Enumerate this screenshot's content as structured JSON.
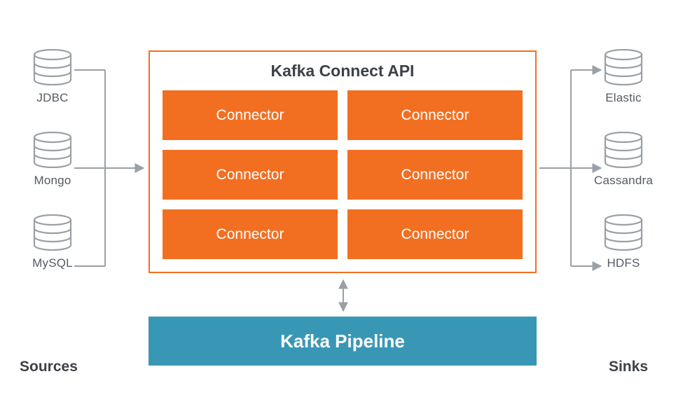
{
  "connect": {
    "title": "Kafka Connect API",
    "connectors": [
      "Connector",
      "Connector",
      "Connector",
      "Connector",
      "Connector",
      "Connector"
    ]
  },
  "pipeline": {
    "label": "Kafka Pipeline"
  },
  "sources": {
    "section_label": "Sources",
    "items": [
      {
        "label": "JDBC"
      },
      {
        "label": "Mongo"
      },
      {
        "label": "MySQL"
      }
    ]
  },
  "sinks": {
    "section_label": "Sinks",
    "items": [
      {
        "label": "Elastic"
      },
      {
        "label": "Cassandra"
      },
      {
        "label": "HDFS"
      }
    ]
  },
  "colors": {
    "connector_bg": "#f26f21",
    "connect_border": "#f26f21",
    "pipeline_bg": "#3997b6",
    "text": "#434a54",
    "arrow": "#9aa0a6"
  }
}
